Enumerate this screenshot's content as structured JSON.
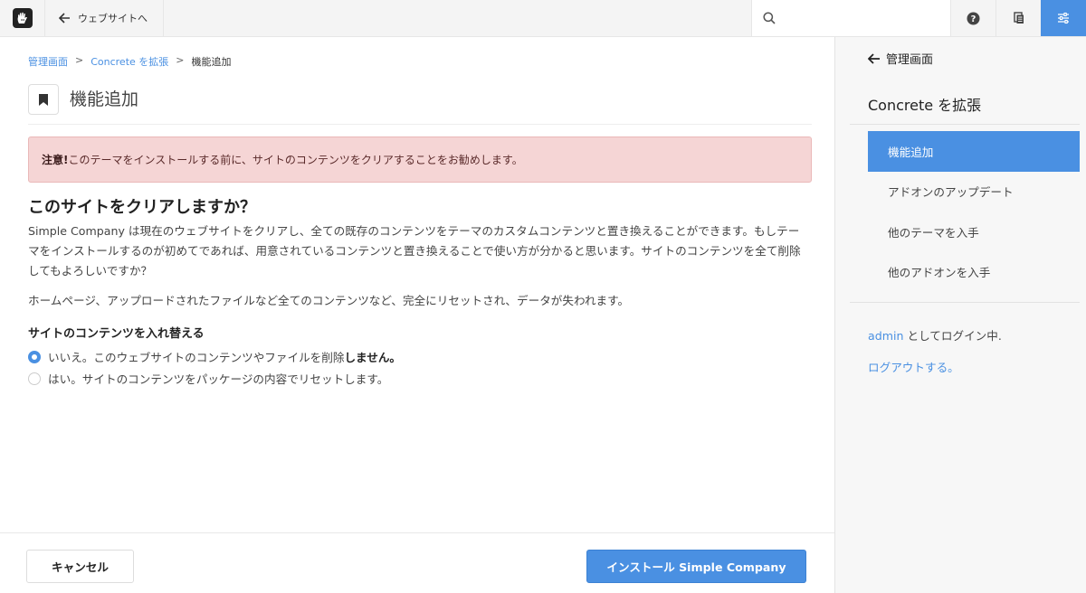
{
  "topbar": {
    "back_label": "ウェブサイトへ",
    "search_placeholder": ""
  },
  "breadcrumb": {
    "items": [
      "管理画面",
      "Concrete を拡張",
      "機能追加"
    ],
    "separator": ">"
  },
  "page": {
    "title": "機能追加"
  },
  "alert": {
    "strong": "注意!",
    "text": "このテーマをインストールする前に、サイトのコンテンツをクリアすることをお勧めします。"
  },
  "content": {
    "heading": "このサイトをクリアしますか？",
    "para1": "Simple Company は現在のウェブサイトをクリアし、全ての既存のコンテンツをテーマのカスタムコンテンツと置き換えることができます。もしテーマをインストールするのが初めてであれば、用意されているコンテンツと置き換えることで使い方が分かると思います。サイトのコンテンツを全て削除してもよろしいですか？",
    "para2": "ホームページ、アップロードされたファイルなど全てのコンテンツなど、完全にリセットされ、データが失われます。",
    "section_label": "サイトのコンテンツを入れ替える",
    "option1_prefix": "いいえ。このウェブサイトのコンテンツやファイルを削除",
    "option1_bold": "しません。",
    "option2": "はい。サイトのコンテンツをパッケージの内容でリセットします。",
    "selected_option": 1
  },
  "footer": {
    "cancel_label": "キャンセル",
    "install_label": "インストール Simple Company"
  },
  "sidebar": {
    "back_label": "管理画面",
    "title": "Concrete を拡張",
    "items": [
      {
        "label": "機能追加",
        "active": true
      },
      {
        "label": "アドオンのアップデート",
        "active": false
      },
      {
        "label": "他のテーマを入手",
        "active": false
      },
      {
        "label": "他のアドオンを入手",
        "active": false
      }
    ],
    "login_user": "admin",
    "login_suffix": " としてログイン中.",
    "logout_label": "ログアウトする。"
  },
  "colors": {
    "accent": "#4a90e2",
    "alert_bg": "#f5d5d5"
  }
}
